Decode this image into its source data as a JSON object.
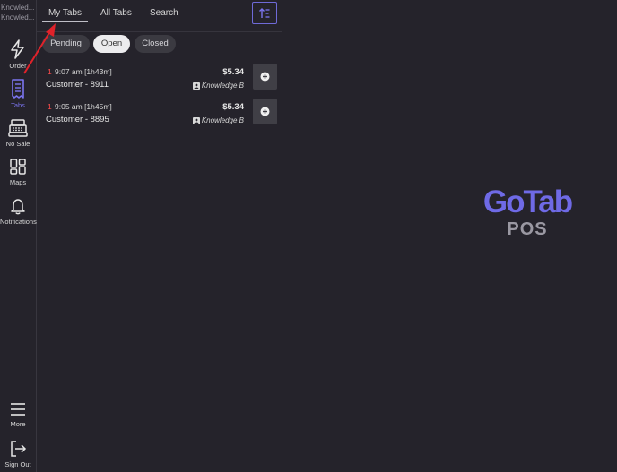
{
  "user": {
    "line1": "Knowled...",
    "line2": "Knowled..."
  },
  "nav": {
    "order": "Order",
    "tabs": "Tabs",
    "no_sale": "No Sale",
    "maps": "Maps",
    "notifications": "Notifications",
    "more": "More",
    "sign_out": "Sign Out"
  },
  "top_tabs": {
    "my_tabs": "My Tabs",
    "all_tabs": "All Tabs",
    "search": "Search"
  },
  "filters": {
    "pending": "Pending",
    "open": "Open",
    "closed": "Closed",
    "selected": "Open"
  },
  "rows": [
    {
      "count": "1",
      "time": "9:07 am [1h43m]",
      "customer": "Customer - 8911",
      "amount": "$5.34",
      "server": "Knowledge B"
    },
    {
      "count": "1",
      "time": "9:05 am [1h45m]",
      "customer": "Customer - 8895",
      "amount": "$5.34",
      "server": "Knowledge B"
    }
  ],
  "logo": {
    "main": "GoTab",
    "sub": "POS"
  },
  "colors": {
    "accent": "#7b75f0",
    "background": "#25232b",
    "badge_red": "#ff4b4b"
  }
}
